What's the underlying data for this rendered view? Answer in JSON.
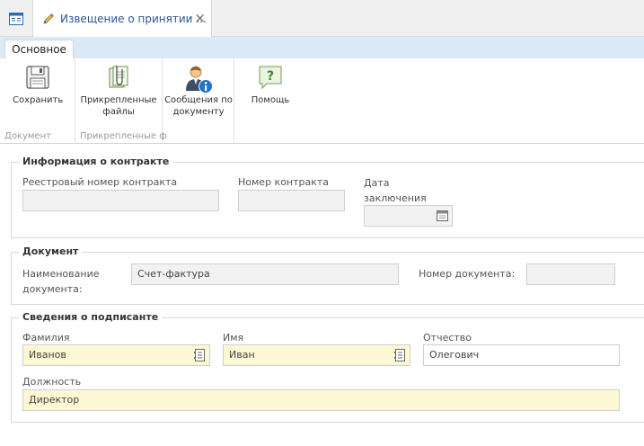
{
  "tabs": {
    "home_icon": "window-list-icon",
    "active_title": "Извещение о принятии ...",
    "close": "×"
  },
  "ribbon": {
    "tab_label": "Основное",
    "groups": [
      {
        "label": "Документ",
        "buttons": [
          {
            "label": "Сохранить",
            "icon": "floppy-disk-icon"
          }
        ]
      },
      {
        "label": "Прикрепленные ф",
        "buttons": [
          {
            "label": "Прикрепленные\nфайлы",
            "icon": "paperclip-document-icon"
          }
        ]
      },
      {
        "label": "",
        "buttons": [
          {
            "label": "Сообщения по\nдокументу",
            "icon": "user-info-icon"
          }
        ]
      },
      {
        "label": "",
        "buttons": [
          {
            "label": "Помощь",
            "icon": "help-bubble-icon"
          }
        ]
      }
    ]
  },
  "contract": {
    "legend": "Информация о контракте",
    "registry_label": "Реестровый номер контракта",
    "registry_value": "",
    "number_label": "Номер контракта",
    "number_value": "",
    "date_label": "Дата\nзаключения",
    "date_value": ""
  },
  "document": {
    "legend": "Документ",
    "name_label": "Наименование\nдокумента:",
    "name_value": "Счет-фактура",
    "docnum_label": "Номер документа:",
    "docnum_value": ""
  },
  "signer": {
    "legend": "Сведения о подписанте",
    "last_name_label": "Фамилия",
    "last_name_value": "Иванов",
    "first_name_label": "Имя",
    "first_name_value": "Иван",
    "middle_name_label": "Отчество",
    "middle_name_value": "Олегович",
    "position_label": "Должность",
    "position_value": "Директор"
  },
  "colors": {
    "accent": "#2b5797",
    "ribbon_tabs_bg": "#dce9f7",
    "required_field_bg": "#fdf7d3",
    "readonly_field_bg": "#f2f2f2"
  }
}
